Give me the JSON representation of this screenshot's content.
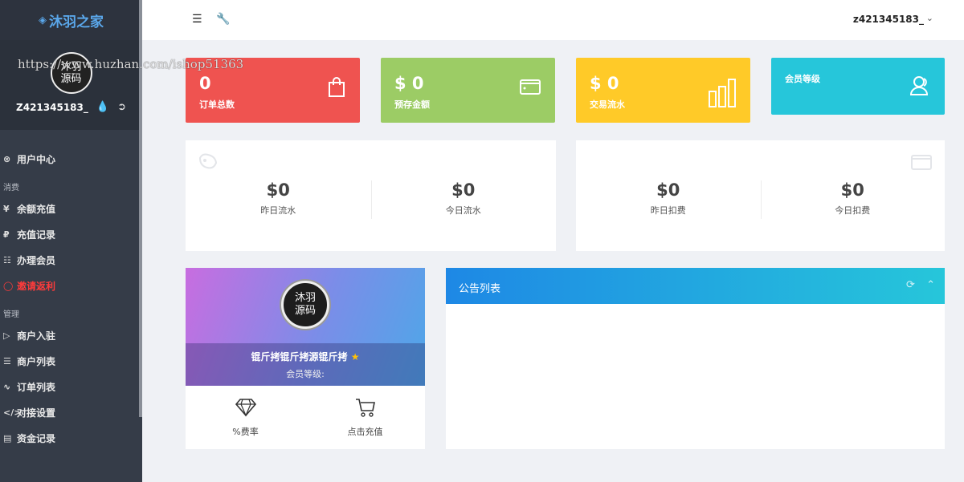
{
  "sidebar": {
    "logo": "沐羽之家",
    "logo_icon": "flame-icon",
    "avatar_text_top": "沐羽",
    "avatar_text_bottom": "源码",
    "username": "Z421345183_",
    "items_top": [
      {
        "label": "用户中心",
        "icon": "plug-icon"
      }
    ],
    "section_consume": "消费",
    "items_consume": [
      {
        "label": "余额充值",
        "icon": "yen-icon"
      },
      {
        "label": "充值记录",
        "icon": "ruble-icon"
      },
      {
        "label": "办理会员",
        "icon": "cart-icon"
      },
      {
        "label": "邀请返利",
        "icon": "user-icon"
      }
    ],
    "section_manage": "管理",
    "items_manage": [
      {
        "label": "商户入驻",
        "icon": "send-icon"
      },
      {
        "label": "商户列表",
        "icon": "list-icon"
      },
      {
        "label": "订单列表",
        "icon": "chart-line-icon"
      },
      {
        "label": "对接设置",
        "icon": "code-icon"
      },
      {
        "label": "资金记录",
        "icon": "wallet-icon"
      }
    ]
  },
  "watermark": "https://www.huzhan.com/ishop51363",
  "topbar": {
    "user": "z421345183_"
  },
  "cards": {
    "orders": {
      "value": "0",
      "label": "订单总数"
    },
    "deposit": {
      "value": "$ 0",
      "label": "预存金额"
    },
    "flow": {
      "value": "$ 0",
      "label": "交易流水"
    },
    "level": {
      "label": "会员等级"
    }
  },
  "panel_flow": {
    "yesterday_value": "$0",
    "yesterday_label": "昨日流水",
    "today_value": "$0",
    "today_label": "今日流水"
  },
  "panel_fee": {
    "yesterday_value": "$0",
    "yesterday_label": "昨日扣费",
    "today_value": "$0",
    "today_label": "今日扣费"
  },
  "profile": {
    "name": "锟斤拷锟斤拷源锟斤拷",
    "level": "会员等级:",
    "rate_label": "%费率",
    "recharge_label": "点击充值"
  },
  "notice": {
    "title": "公告列表"
  },
  "colors": {
    "red": "#ef5350",
    "green": "#9ccc65",
    "yellow": "#ffca28",
    "cyan": "#26c6da",
    "sidebar": "#353c48",
    "accent_blue": "#1e88e5"
  }
}
